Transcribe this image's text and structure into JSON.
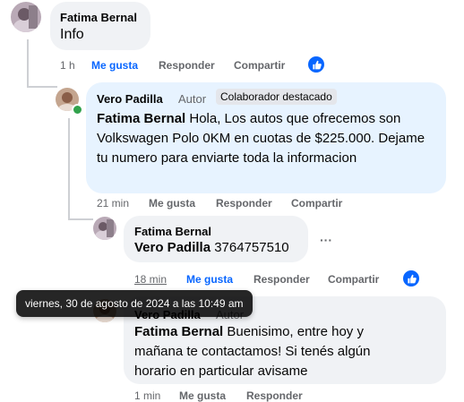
{
  "comment1": {
    "author": "Fatima Bernal",
    "text": "Info",
    "time": "1 h",
    "like": "Me gusta",
    "reply": "Responder",
    "share": "Compartir"
  },
  "comment2": {
    "author": "Vero Padilla",
    "role": "Autor",
    "badge": "Colaborador destacado",
    "mention": "Fatima Bernal",
    "text": " Hola, Los autos que ofrecemos son Volkswagen Polo 0KM en cuotas de $225.000. Dejame tu numero para enviarte toda la informacion",
    "time": "21 min",
    "like": "Me gusta",
    "reply": "Responder",
    "share": "Compartir"
  },
  "comment3": {
    "author": "Fatima Bernal",
    "mention": "Vero Padilla",
    "text": " 3764757510",
    "more": "···",
    "time": "18 min",
    "like": "Me gusta",
    "reply": "Responder",
    "share": "Compartir"
  },
  "comment4": {
    "author": "Vero Padilla",
    "role": "Autor",
    "mention": "Fatima Bernal",
    "text": " Buenisimo, entre hoy y mañana te contactamos! Si tenés algún horario en particular avisame",
    "time": "1 min",
    "like": "Me gusta",
    "reply": "Responder"
  },
  "tooltip": "viernes, 30 de agosto de 2024 a las 10:49 am",
  "colors": {
    "accent": "#0866ff",
    "bubble": "#f0f2f5",
    "highlight": "#e7f3ff"
  }
}
